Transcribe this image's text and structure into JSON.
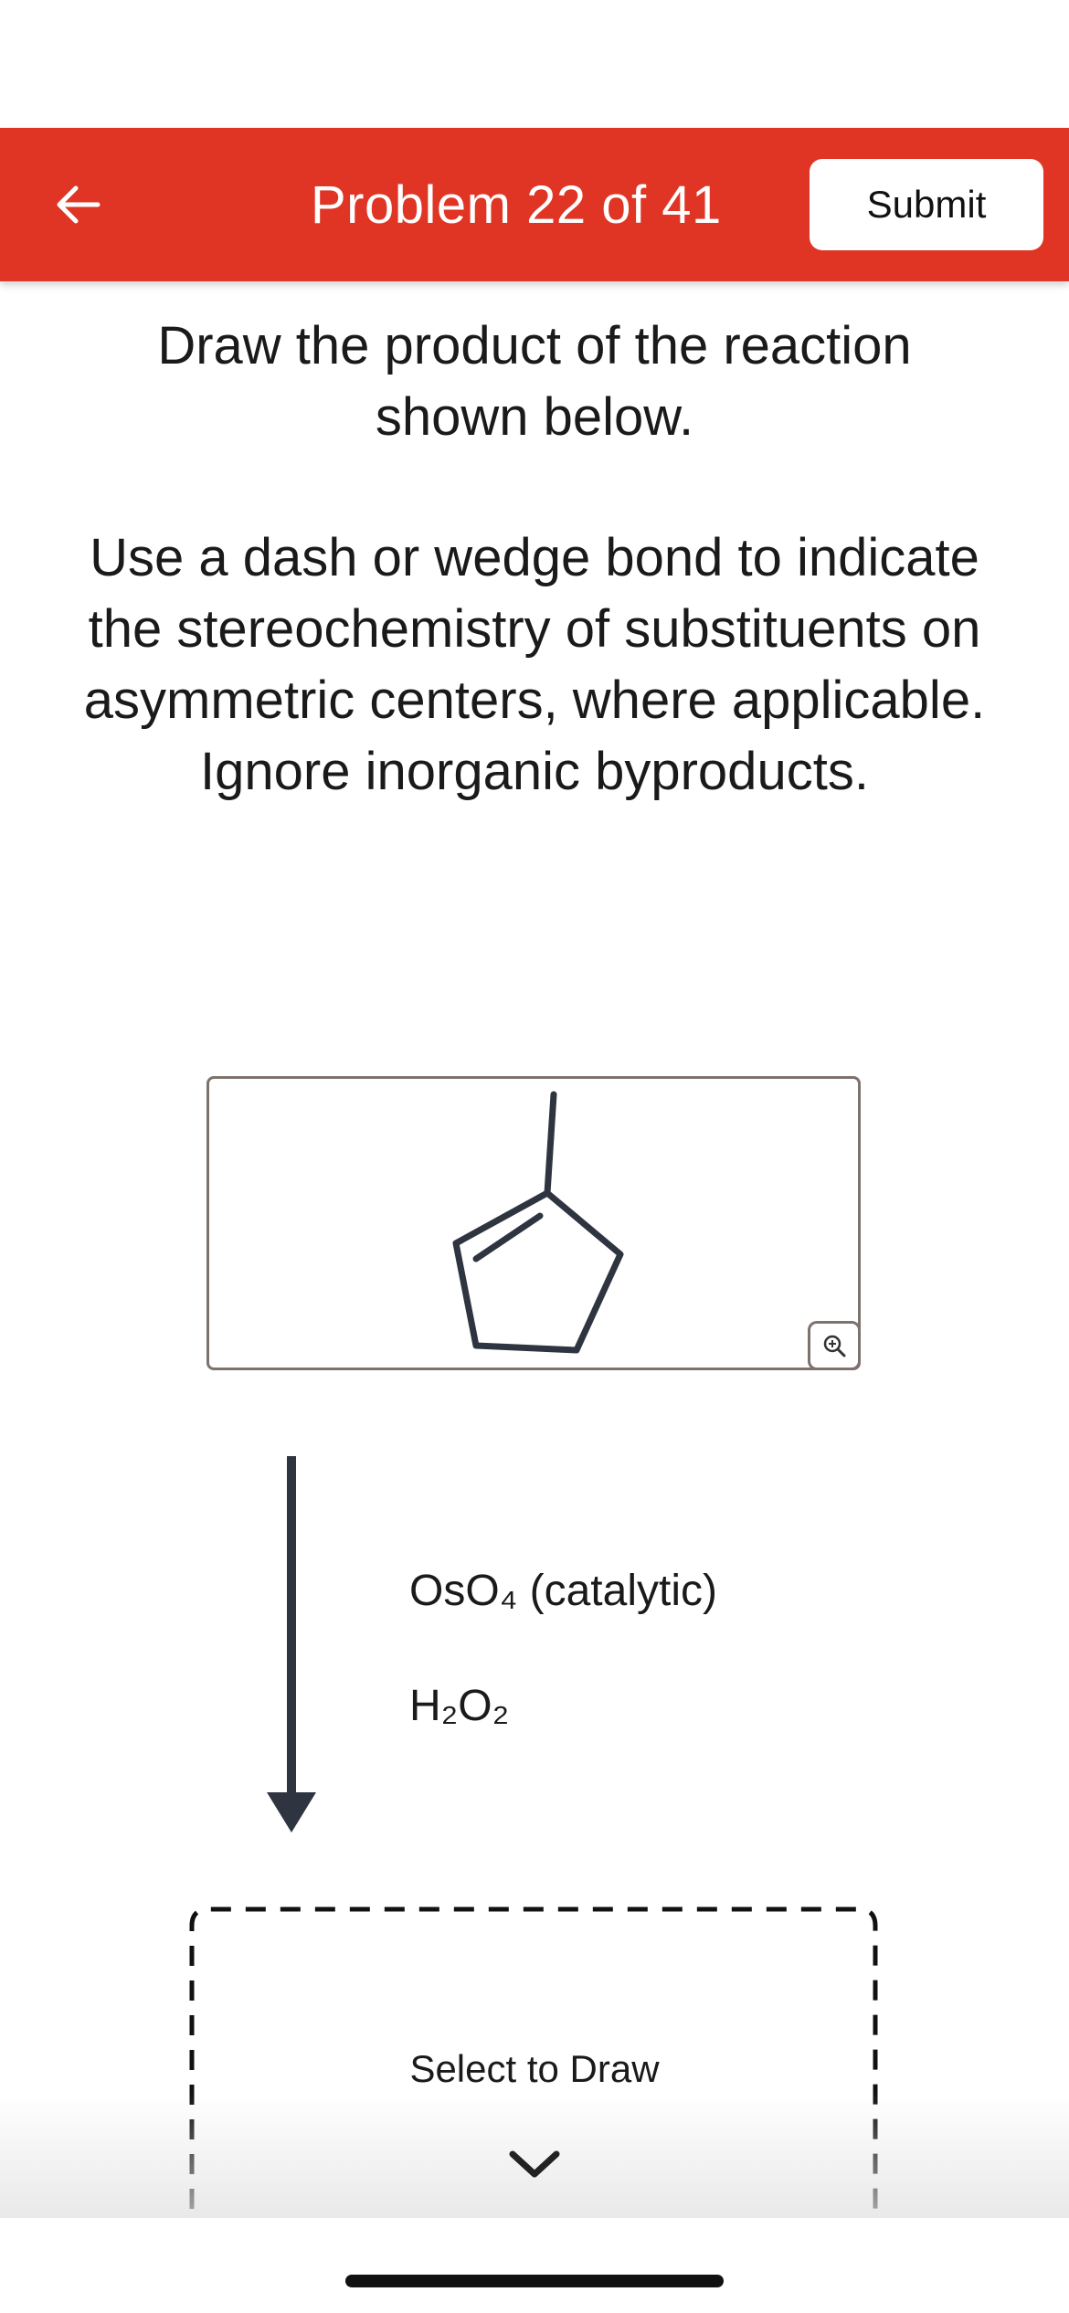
{
  "header": {
    "back_icon": "back-arrow-icon",
    "title": "Problem 22 of 41",
    "submit_label": "Submit",
    "background_color": "#e03524"
  },
  "instructions": {
    "line1": "Draw the product of the reaction shown below.",
    "line2": "Use a dash or wedge bond to indicate the stereochemistry of substituents on asymmetric centers, where applicable. Ignore inorganic byproducts."
  },
  "reactant": {
    "molecule": "1-methylcyclopentene",
    "zoom_icon": "zoom-in-icon"
  },
  "reagents": {
    "reagent1": "OsO₄ (catalytic)",
    "reagent2": "H₂O₂"
  },
  "product": {
    "draw_label": "Select to Draw",
    "chevron_icon": "chevron-down-icon"
  }
}
